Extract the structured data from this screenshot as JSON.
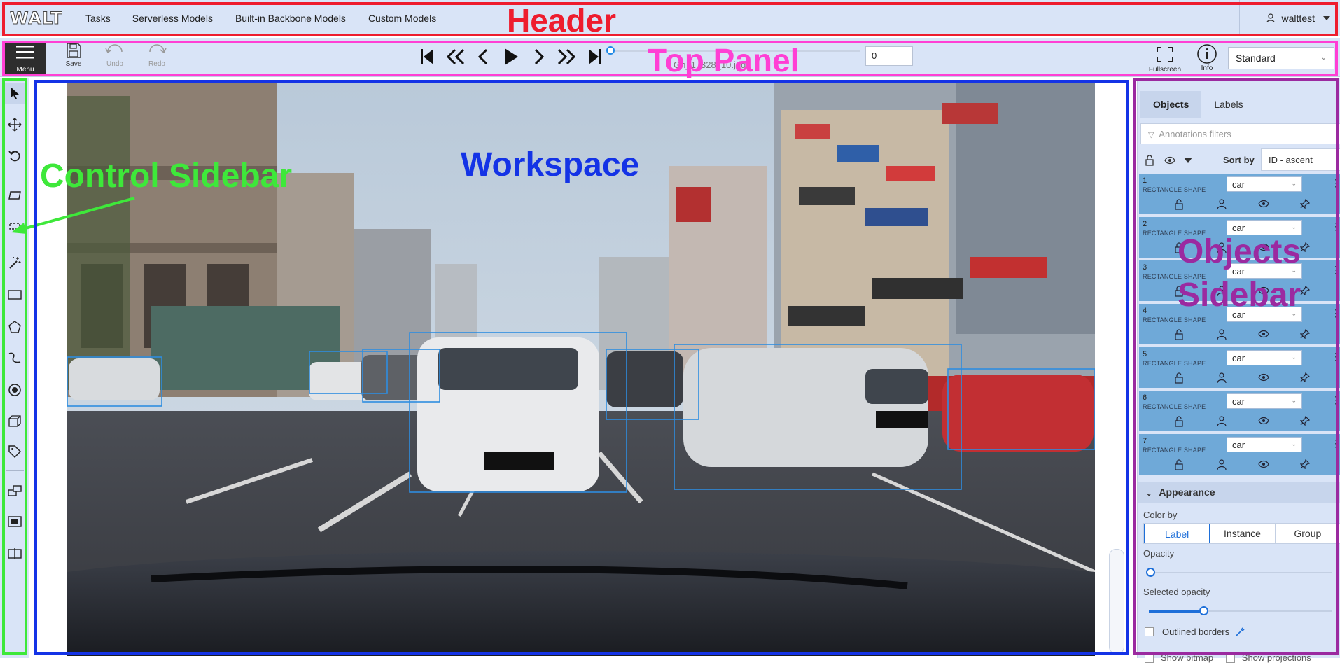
{
  "header": {
    "logo": "WALT",
    "nav": [
      "Tasks",
      "Serverless Models",
      "Built-in Backbone Models",
      "Custom Models"
    ],
    "username": "walttest"
  },
  "top_panel": {
    "menu_label": "Menu",
    "save_label": "Save",
    "undo_label": "Undo",
    "redo_label": "Redo",
    "filename": "Gn_1_328_10.jpg",
    "frame_number": "0",
    "fullscreen_label": "Fullscreen",
    "info_label": "Info",
    "workspace_mode": "Standard"
  },
  "objects_sidebar": {
    "tabs": [
      "Objects",
      "Labels"
    ],
    "filter_placeholder": "Annotations filters",
    "sort_by_label": "Sort by",
    "sort_value": "ID - ascent",
    "objects": [
      {
        "id": "1",
        "type": "RECTANGLE SHAPE",
        "label": "car"
      },
      {
        "id": "2",
        "type": "RECTANGLE SHAPE",
        "label": "car"
      },
      {
        "id": "3",
        "type": "RECTANGLE SHAPE",
        "label": "car"
      },
      {
        "id": "4",
        "type": "RECTANGLE SHAPE",
        "label": "car"
      },
      {
        "id": "5",
        "type": "RECTANGLE SHAPE",
        "label": "car"
      },
      {
        "id": "6",
        "type": "RECTANGLE SHAPE",
        "label": "car"
      },
      {
        "id": "7",
        "type": "RECTANGLE SHAPE",
        "label": "car"
      }
    ],
    "appearance": {
      "title": "Appearance",
      "color_by_label": "Color by",
      "color_by_options": [
        "Label",
        "Instance",
        "Group"
      ],
      "color_by_selected": "Label",
      "opacity_label": "Opacity",
      "opacity_value": 0.0,
      "selected_opacity_label": "Selected opacity",
      "selected_opacity_value": 0.3,
      "outlined_borders_label": "Outlined borders",
      "show_bitmap_label": "Show bitmap",
      "show_projections_label": "Show projections"
    }
  },
  "annotations": {
    "header": "Header",
    "top_panel": "Top Panel",
    "control_sidebar": "Control Sidebar",
    "workspace": "Workspace",
    "objects_sidebar_line1": "Objects",
    "objects_sidebar_line2": "Sidebar",
    "colors": {
      "header": "#ee1c2e",
      "top_panel": "#ff3fd4",
      "control_sidebar": "#3ee83a",
      "workspace": "#1433e6",
      "objects_sidebar": "#9b2aa0"
    }
  },
  "colors": {
    "chrome_bg": "#d9e4f7",
    "object_item_bg": "#6fa9d8",
    "bbox": "#2e8de0"
  }
}
